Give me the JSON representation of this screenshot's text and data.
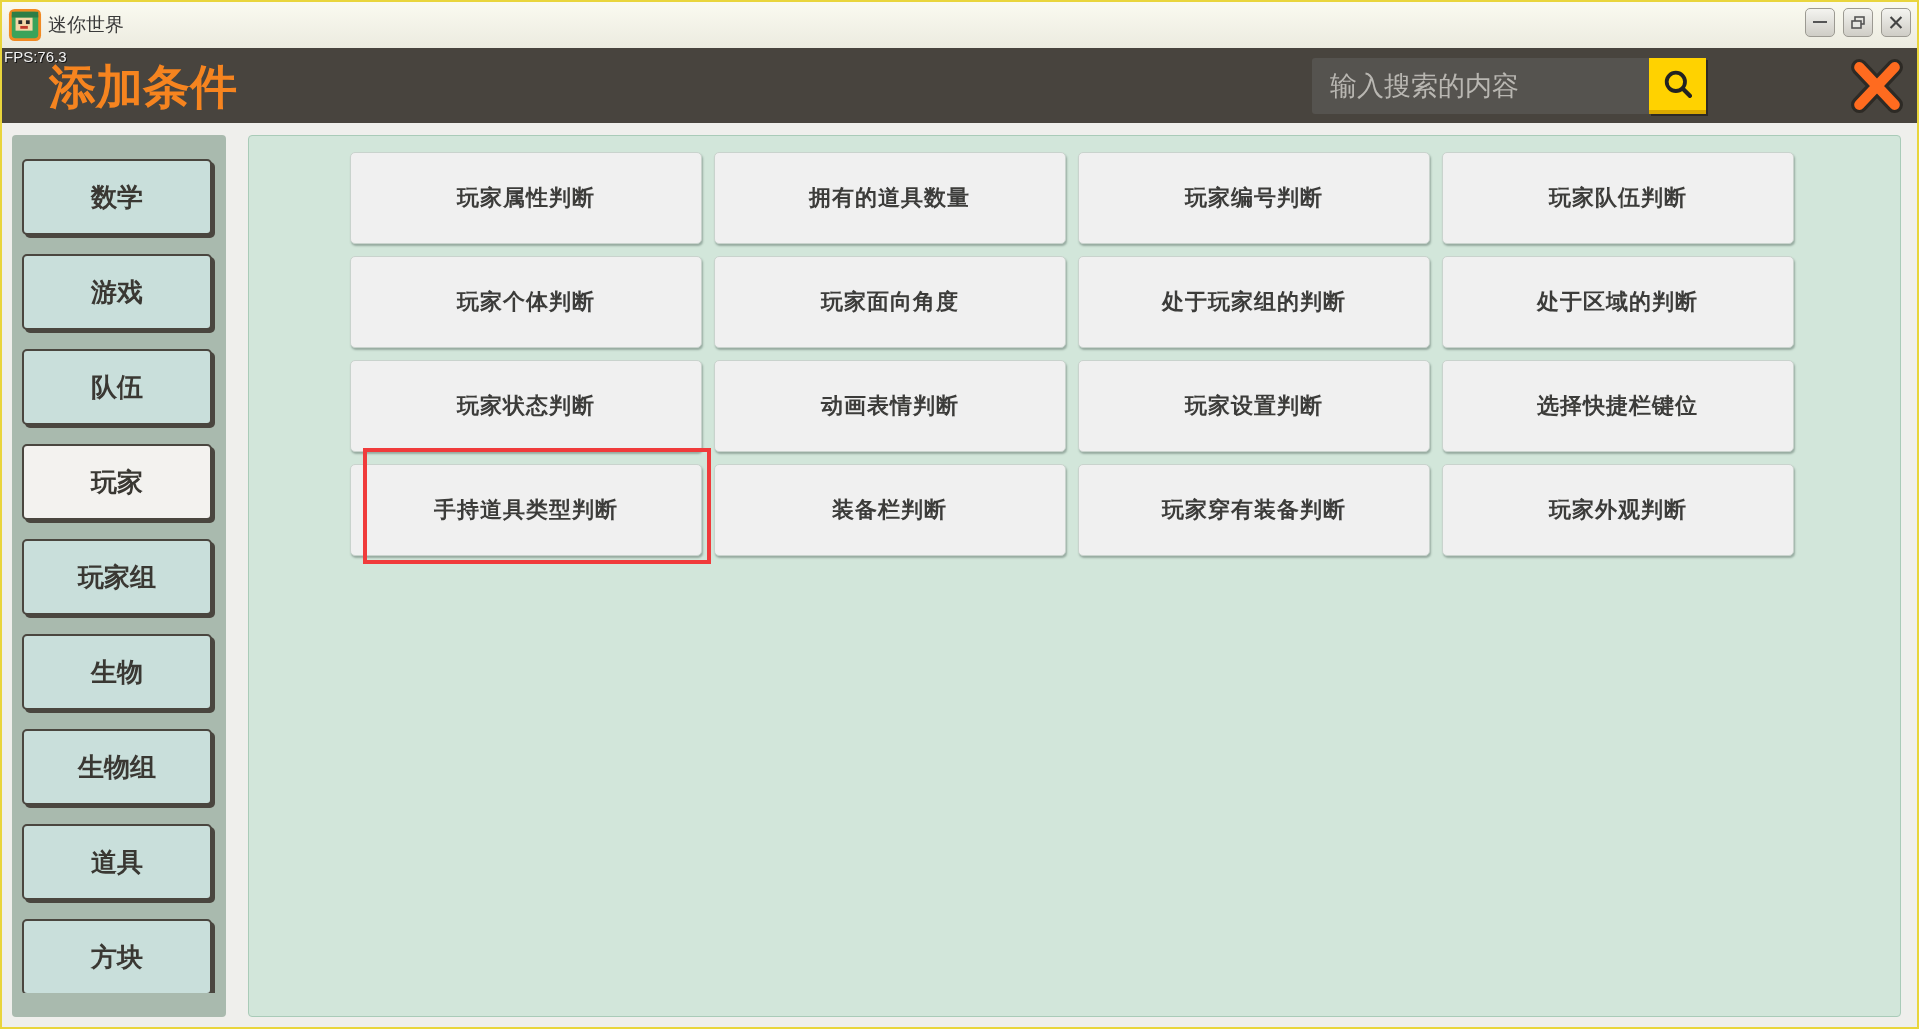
{
  "window": {
    "title": "迷你世界"
  },
  "fps": "FPS:76.3",
  "header": {
    "title": "添加条件",
    "search": {
      "placeholder": "输入搜索的内容"
    }
  },
  "sidebar": {
    "items": [
      {
        "label": "数学",
        "selected": false
      },
      {
        "label": "游戏",
        "selected": false
      },
      {
        "label": "队伍",
        "selected": false
      },
      {
        "label": "玩家",
        "selected": true
      },
      {
        "label": "玩家组",
        "selected": false
      },
      {
        "label": "生物",
        "selected": false
      },
      {
        "label": "生物组",
        "selected": false
      },
      {
        "label": "道具",
        "selected": false
      },
      {
        "label": "方块",
        "selected": false
      }
    ]
  },
  "conditions": {
    "items": [
      {
        "label": "玩家属性判断",
        "highlighted": false
      },
      {
        "label": "拥有的道具数量",
        "highlighted": false
      },
      {
        "label": "玩家编号判断",
        "highlighted": false
      },
      {
        "label": "玩家队伍判断",
        "highlighted": false
      },
      {
        "label": "玩家个体判断",
        "highlighted": false
      },
      {
        "label": "玩家面向角度",
        "highlighted": false
      },
      {
        "label": "处于玩家组的判断",
        "highlighted": false
      },
      {
        "label": "处于区域的判断",
        "highlighted": false
      },
      {
        "label": "玩家状态判断",
        "highlighted": false
      },
      {
        "label": "动画表情判断",
        "highlighted": false
      },
      {
        "label": "玩家设置判断",
        "highlighted": false
      },
      {
        "label": "选择快捷栏键位",
        "highlighted": false
      },
      {
        "label": "手持道具类型判断",
        "highlighted": true
      },
      {
        "label": "装备栏判断",
        "highlighted": false
      },
      {
        "label": "玩家穿有装备判断",
        "highlighted": false
      },
      {
        "label": "玩家外观判断",
        "highlighted": false
      }
    ]
  }
}
